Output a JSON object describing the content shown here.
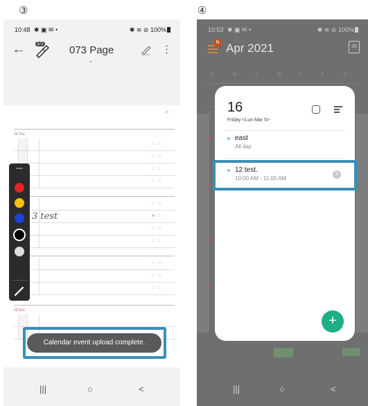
{
  "steps": {
    "left": "③",
    "right": "④"
  },
  "left_phone": {
    "status": {
      "time": "10:48",
      "icons": "✱ ▣ ✉ •",
      "right_icons": "✱ ≋ ⊘",
      "battery": "100%"
    },
    "toolbar": {
      "back_icon": "arrow-left-icon",
      "pen_badge": "1/1",
      "title": "073 Page",
      "chevron": "⌄",
      "pencil_icon": "pencil-icon",
      "menu_icon": "kebab-icon"
    },
    "planner": {
      "share_mark": "<",
      "header_top": "16 Thu",
      "header_bottom": "18 Sun",
      "handwriting": "3  test"
    },
    "palette": {
      "colors": [
        {
          "name": "red",
          "hex": "#e3222a"
        },
        {
          "name": "yellow",
          "hex": "#f4c20d"
        },
        {
          "name": "blue",
          "hex": "#1c44d8"
        },
        {
          "name": "black",
          "hex": "#000000"
        },
        {
          "name": "gray",
          "hex": "#dcdcdc"
        }
      ],
      "selected": "black"
    },
    "toast": {
      "message": "Calendar event upload complete."
    },
    "highlight_color": "#3a8fb6",
    "nav": {
      "recent": "|||",
      "home": "○",
      "back": "<"
    }
  },
  "right_phone": {
    "status": {
      "time": "10:53",
      "icons": "✱ ▣ ✉ •",
      "right_icons": "✱ ≋ ⊘",
      "battery": "100%"
    },
    "header": {
      "menu_badge": "N",
      "month": "Apr 2021",
      "calendar_icon_label": "30"
    },
    "weekdays": [
      "S",
      "M",
      "T",
      "W",
      "T",
      "F",
      "S"
    ],
    "popup": {
      "day_number": "16",
      "day_subtitle": "Friday <Lun Mar 5>",
      "events": [
        {
          "title": "east",
          "time": "All day"
        },
        {
          "title": "12 test.",
          "time": "10:00 AM - 11:00 AM",
          "badge": "S"
        }
      ],
      "add_label": "+",
      "fab_color": "#1fae86"
    },
    "nav": {
      "recent": "|||",
      "home": "○",
      "back": "<"
    }
  }
}
